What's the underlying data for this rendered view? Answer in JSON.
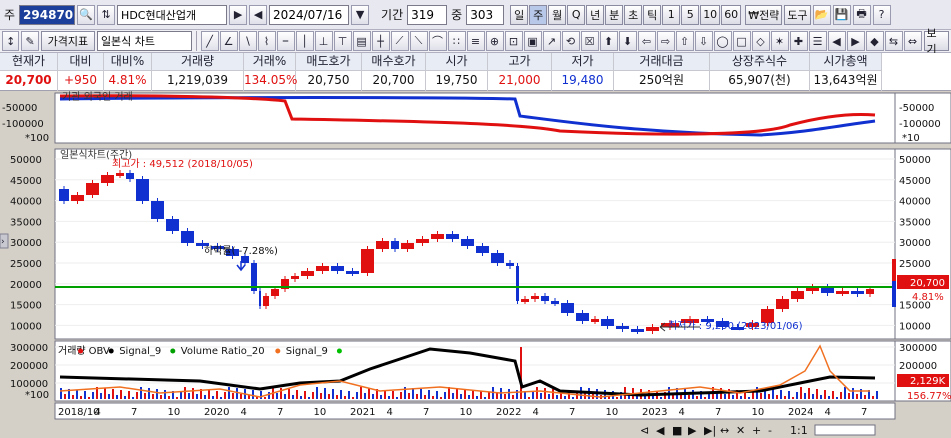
{
  "toolbar": {
    "market_label": "주",
    "code": "294870",
    "name": "HDC현대산업개",
    "date": "2024/07/16",
    "period_label": "기간",
    "period_value": "319",
    "overlap_label": "중",
    "overlap_value": "303",
    "units": [
      "일",
      "주",
      "월",
      "Q",
      "년",
      "분",
      "초",
      "틱",
      "1",
      "5",
      "10",
      "60"
    ],
    "active_unit": "주",
    "strategy_label": "₩전략",
    "tools_label": "도구",
    "view_label": "보기"
  },
  "toolbar2": {
    "indicator_label": "가격지표",
    "chart_type": "일본식 차트"
  },
  "quote": {
    "headers": [
      "현재가",
      "대비",
      "대비%",
      "거래량",
      "거래%",
      "매도호가",
      "매수호가",
      "시가",
      "고가",
      "저가",
      "거래대금",
      "상장주식수",
      "시가총액"
    ],
    "values": [
      "20,700",
      "+950",
      "4.81%",
      "1,219,039",
      "134.05%",
      "20,750",
      "20,700",
      "19,750",
      "21,000",
      "19,480",
      "250억원",
      "65,907(천)",
      "13,643억원"
    ]
  },
  "top_panel": {
    "legend": "기관 외국인 거래",
    "y_ticks": [
      "-50000",
      "-100000"
    ],
    "scale_left": "*100",
    "scale_right": "*10"
  },
  "price_panel": {
    "title": "일본식차트(주간)",
    "high_label": "최고가 : 49,512 (2018/10/05)",
    "low_label": "최저가 : 9,290 (2023/01/06)",
    "fall_label": "하락률( -7.28%)",
    "y_ticks": [
      "50000",
      "45000",
      "40000",
      "35000",
      "30000",
      "25000",
      "20000",
      "15000",
      "10000"
    ],
    "current_price": "20,700",
    "change_pct": "4.81%"
  },
  "volume_panel": {
    "legend": [
      "거래량",
      "OBV",
      "Signal_9",
      "Volume Ratio_20",
      "Signal_9"
    ],
    "y_ticks": [
      "300000",
      "200000",
      "100000"
    ],
    "scale_left": "*100",
    "obv_value": "2,129K",
    "ratio_value": "156.77%"
  },
  "x_axis": [
    "2018/10",
    "4",
    "7",
    "10",
    "2020",
    "4",
    "7",
    "10",
    "2021",
    "4",
    "7",
    "10",
    "2022",
    "4",
    "7",
    "10",
    "2023",
    "4",
    "7",
    "10",
    "2024",
    "4",
    "7"
  ],
  "status": {
    "zoom": "1:1"
  },
  "colors": {
    "up": "#e01010",
    "down": "#1030d0",
    "support_line": "#00a000",
    "header_bg": "#1b3f9a"
  }
}
